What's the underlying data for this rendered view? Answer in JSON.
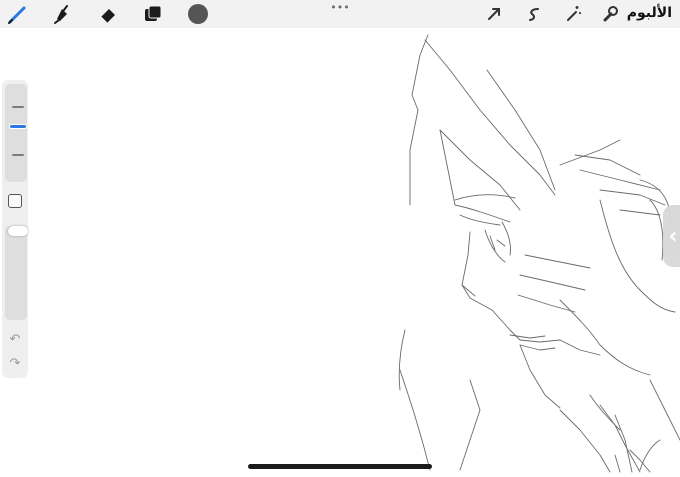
{
  "toolbar": {
    "gallery_label": "الألبوم",
    "more_dots": "•••",
    "left_tools": [
      "brush-icon",
      "smudge-icon",
      "eraser-icon",
      "layers-icon"
    ],
    "right_tools": [
      "wrench-icon",
      "magic-wand-icon",
      "selection-icon",
      "transform-arrow-icon"
    ],
    "current_color": "#555555"
  },
  "sidebar": {
    "brush_size": 0.58,
    "opacity": 1.0,
    "undo_symbol": "↶",
    "redo_symbol": "↷"
  },
  "canvas": {
    "background": "#ffffff",
    "content": "line-art-sketch"
  },
  "side_handle": {
    "symbol": "‹"
  },
  "accent": "#2d78e0"
}
